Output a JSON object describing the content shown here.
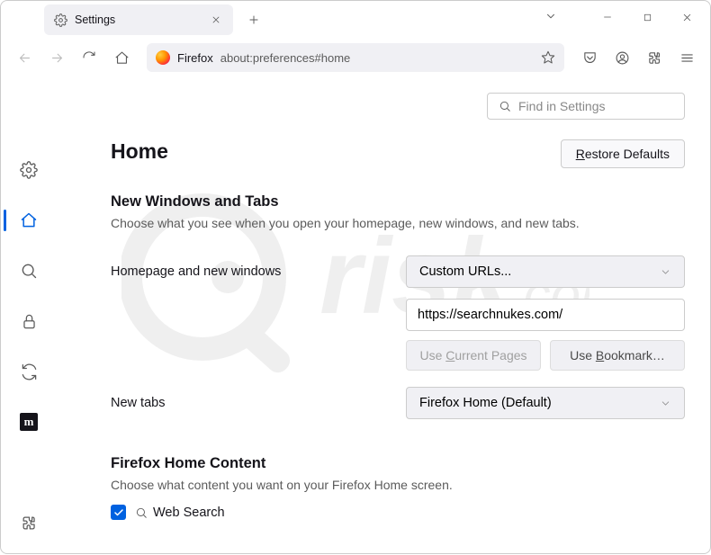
{
  "tab": {
    "label": "Settings"
  },
  "url": {
    "firefox_label": "Firefox",
    "address": "about:preferences#home"
  },
  "search": {
    "placeholder": "Find in Settings"
  },
  "page": {
    "title": "Home",
    "restore_btn_pre": "R",
    "restore_btn_rest": "estore Defaults"
  },
  "nwt": {
    "heading": "New Windows and Tabs",
    "sub": "Choose what you see when you open your homepage, new windows, and new tabs.",
    "homepage_label": "Homepage and new windows",
    "homepage_mode": "Custom URLs...",
    "homepage_url": "https://searchnukes.com/",
    "use_current_pre": "Use ",
    "use_current_u": "C",
    "use_current_rest": "urrent Pages",
    "use_bookmark_pre": "Use ",
    "use_bookmark_u": "B",
    "use_bookmark_rest": "ookmark…",
    "newtabs_label": "New tabs",
    "newtabs_mode": "Firefox Home (Default)"
  },
  "fhc": {
    "heading": "Firefox Home Content",
    "sub": "Choose what content you want on your Firefox Home screen.",
    "web_search": "Web Search"
  }
}
